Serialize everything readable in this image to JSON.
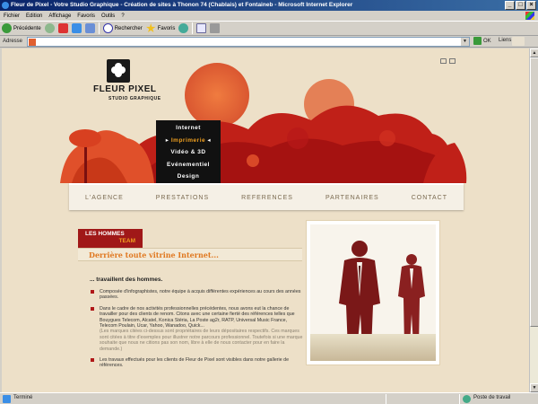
{
  "window": {
    "title": "Fleur de Pixel - Votre Studio Graphique - Création de sites à Thonon 74 (Chablais) et Fontaineb - Microsoft Internet Explorer",
    "controls": [
      "_",
      "□",
      "×"
    ]
  },
  "menubar": {
    "items": [
      "Fichier",
      "Edition",
      "Affichage",
      "Favoris",
      "Outils",
      "?"
    ]
  },
  "toolbar": {
    "back_label": "Précédente",
    "search_label": "Rechercher",
    "favorites_label": "Favoris"
  },
  "addressbar": {
    "label": "Adresse",
    "url": "",
    "go_label": "OK",
    "links_label": "Liens"
  },
  "site": {
    "logo_name": "FLEUR PIXEL",
    "logo_sub": "STUDIO GRAPHIQUE",
    "submenu": [
      {
        "label": "Internet",
        "active": false
      },
      {
        "label": "Imprimerie",
        "active": true
      },
      {
        "label": "Vidéo & 3D",
        "active": false
      },
      {
        "label": "Evénementiel",
        "active": false
      },
      {
        "label": "Design",
        "active": false
      }
    ],
    "nav": [
      "L'AGENCE",
      "PRESTATIONS",
      "REFERENCES",
      "PARTENAIRES",
      "CONTACT"
    ],
    "section_tag_1": "LES HOMMES",
    "section_tag_2": "TEAM",
    "tagline": "Derrière toute vitrine Internet...",
    "content_heading": "... travaillent des hommes.",
    "bullets": [
      {
        "text": "Composée d'infographistes, notre équipe à acquis différentes expériences au cours des années passées.",
        "note": ""
      },
      {
        "text": "Dans le cadre de nos activités professionnelles précédentes, nous avons eut la chance de travailler pour des clients de renom. Citons avec une certaine fierté des références telles que Bouygues Telecom, Alcatel, Konica Stéria, La Poste ag2r, RATP, Universal Music France, Telecom Poulain, Ucar, Yahoo, Wanadoo, Quick...",
        "note": "(Les marques citées ci-dessus sont propriétaires de leurs dépositaires respectifs. Ces marques sont citées à titre d'exemples pour illustrer notre parcours professionnel. Toutefois si une marque souhaite que nous ne citions pas son nom, libre à elle de nous contacter pour en faire la demande.)"
      },
      {
        "text": "Les travaux effectués pour les clients de Fleur de Pixel sont visibles dans notre gallerie de références.",
        "note": ""
      }
    ]
  },
  "statusbar": {
    "status": "Terminé",
    "zone": "Poste de travail"
  },
  "colors": {
    "brand_red": "#b01818",
    "accent_orange": "#e07820",
    "page_bg": "#ede0c8"
  }
}
